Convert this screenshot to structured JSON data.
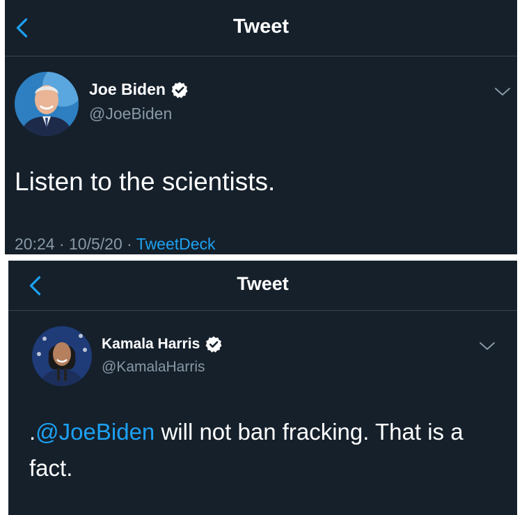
{
  "colors": {
    "background": "#15202b",
    "text": "#ffffff",
    "secondary": "#8899a6",
    "accent": "#1da1f2",
    "divider": "#38444d"
  },
  "panels": [
    {
      "header_title": "Tweet",
      "author": {
        "name": "Joe Biden",
        "handle": "@JoeBiden",
        "verified": true
      },
      "text": "Listen to the scientists.",
      "time": "20:24",
      "separator": " · ",
      "date": "10/5/20",
      "source": "TweetDeck"
    },
    {
      "header_title": "Tweet",
      "author": {
        "name": "Kamala Harris",
        "handle": "@KamalaHarris",
        "verified": true
      },
      "text_prefix": ".",
      "mention": "@JoeBiden",
      "text_rest": " will not ban fracking. That is a fact."
    }
  ],
  "icons": {
    "back": "chevron-left-icon",
    "verified": "verified-badge-icon",
    "more": "chevron-down-icon"
  }
}
